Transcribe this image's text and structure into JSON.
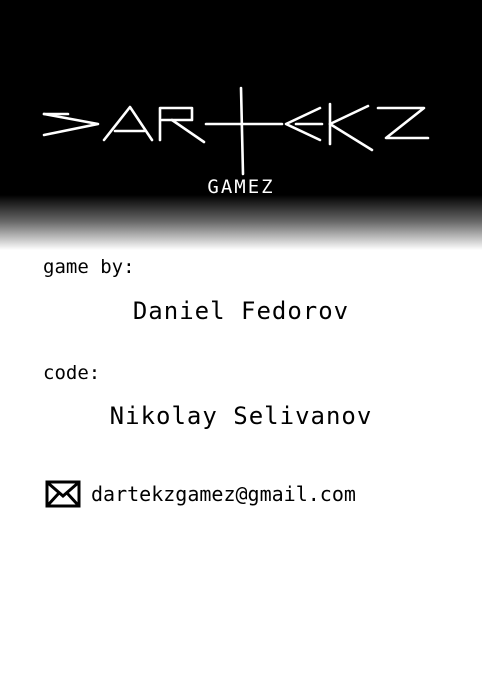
{
  "logo": {
    "wordmark": "DARTEKZ",
    "subtitle": "GAMEZ"
  },
  "credits": [
    {
      "role": "game by:",
      "person": "Daniel Fedorov"
    },
    {
      "role": "code:",
      "person": "Nikolay Selivanov"
    }
  ],
  "contact": {
    "icon": "envelope-icon",
    "email": "dartekzgamez@gmail.com"
  },
  "colors": {
    "header_bg": "#000000",
    "logo": "#ffffff",
    "text": "#000000",
    "page_bg": "#ffffff"
  }
}
